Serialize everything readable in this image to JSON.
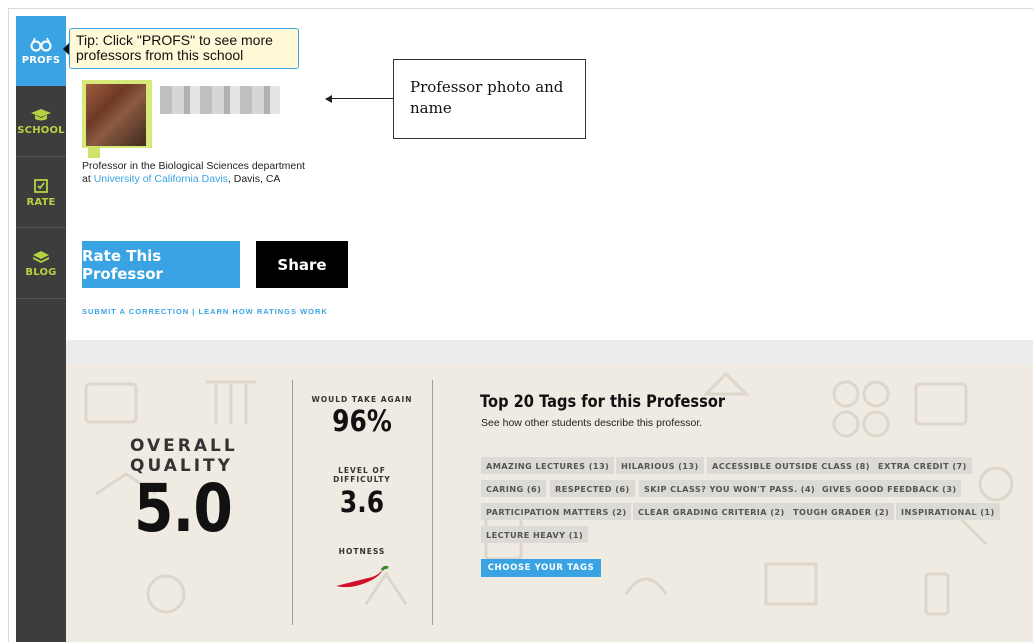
{
  "sidebar": {
    "items": [
      {
        "label": "PROFS",
        "icon": "glasses-icon"
      },
      {
        "label": "SCHOOL",
        "icon": "graduation-cap-icon"
      },
      {
        "label": "RATE",
        "icon": "checkbox-icon"
      },
      {
        "label": "BLOG",
        "icon": "book-icon"
      }
    ],
    "active_color": "#3aa3e3",
    "label_color": "#b5d341"
  },
  "tooltip": {
    "text": "Tip: Click \"PROFS\" to see more professors from this school"
  },
  "annotation": {
    "text": "Professor photo and name"
  },
  "profile": {
    "department_text": "Professor in the Biological Sciences department",
    "at_prefix": "at ",
    "school_link": "University of California Davis",
    "location": ", Davis, CA"
  },
  "buttons": {
    "rate": "Rate This Professor",
    "share": "Share"
  },
  "links": {
    "correction": "SUBMIT A CORRECTION",
    "separator": " | ",
    "learn": "LEARN HOW RATINGS WORK"
  },
  "ratings": {
    "overall_label": "OVERALL QUALITY",
    "overall_value": "5.0",
    "would_take_again_label": "WOULD TAKE AGAIN",
    "would_take_again_value": "96%",
    "difficulty_label": "LEVEL OF DIFFICULTY",
    "difficulty_value": "3.6",
    "hotness_label": "HOTNESS"
  },
  "tags": {
    "title": "Top 20 Tags for this Professor",
    "subtitle": "See how other students describe this professor.",
    "items": [
      "AMAZING LECTURES (13)",
      "HILARIOUS (13)",
      "ACCESSIBLE OUTSIDE CLASS (8)",
      "EXTRA CREDIT (7)",
      "CARING (6)",
      "RESPECTED (6)",
      "SKIP CLASS? YOU WON'T PASS. (4)",
      "GIVES GOOD FEEDBACK (3)",
      "PARTICIPATION MATTERS (2)",
      "CLEAR GRADING CRITERIA (2)",
      "TOUGH GRADER (2)",
      "INSPIRATIONAL (1)",
      "LECTURE HEAVY (1)"
    ],
    "choose_button": "CHOOSE YOUR TAGS"
  }
}
